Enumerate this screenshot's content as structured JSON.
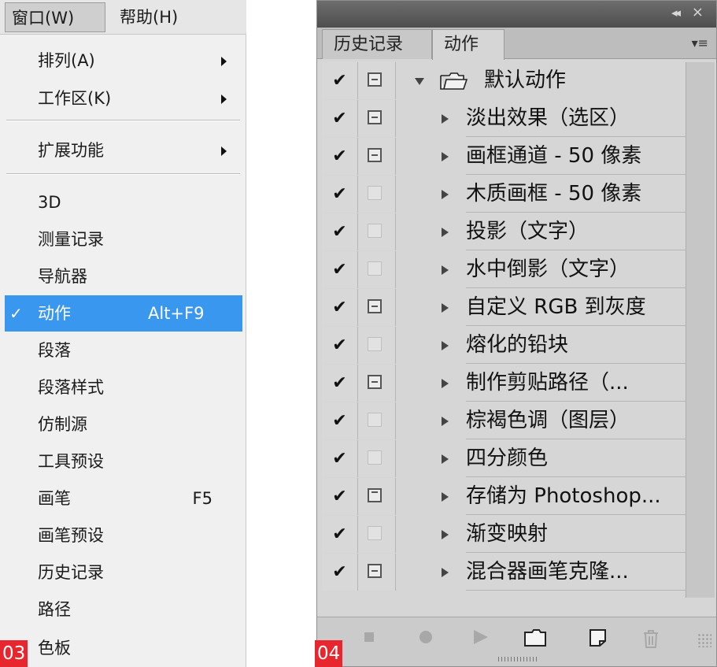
{
  "menubar": {
    "window_label": "窗口(W)",
    "help_label": "帮助(H)"
  },
  "window_menu": {
    "items": [
      {
        "label": "排列(A)",
        "submenu": true
      },
      {
        "label": "工作区(K)",
        "submenu": true
      },
      {
        "label": "扩展功能",
        "submenu": true
      },
      {
        "label": "3D"
      },
      {
        "label": "测量记录"
      },
      {
        "label": "导航器"
      },
      {
        "label": "动作",
        "shortcut": "Alt+F9",
        "checked": true,
        "highlighted": true
      },
      {
        "label": "段落"
      },
      {
        "label": "段落样式"
      },
      {
        "label": "仿制源"
      },
      {
        "label": "工具预设"
      },
      {
        "label": "画笔",
        "shortcut": "F5"
      },
      {
        "label": "画笔预设"
      },
      {
        "label": "历史记录"
      },
      {
        "label": "路径"
      },
      {
        "label": "色板"
      }
    ],
    "check_glyph": "✓"
  },
  "badges": {
    "left": "03",
    "right": "04"
  },
  "actions_panel": {
    "tabs": [
      {
        "label": "历史记录"
      },
      {
        "label": "动作",
        "active": true
      }
    ],
    "collapse_glyph": "◂◂",
    "close_glyph": "×",
    "menu_glyph": "▾≡",
    "check_glyph": "✔",
    "set": {
      "name": "默认动作",
      "dialog": "partial"
    },
    "actions": [
      {
        "name": "淡出效果（选区）",
        "dialog": "partial"
      },
      {
        "name": "画框通道 - 50 像素",
        "dialog": "partial"
      },
      {
        "name": "木质画框 - 50 像素",
        "dialog": "none"
      },
      {
        "name": "投影（文字）",
        "dialog": "none"
      },
      {
        "name": "水中倒影（文字）",
        "dialog": "none"
      },
      {
        "name": "自定义 RGB 到灰度",
        "dialog": "partial"
      },
      {
        "name": "熔化的铅块",
        "dialog": "none"
      },
      {
        "name": "制作剪贴路径（...",
        "dialog": "partial"
      },
      {
        "name": "棕褐色调（图层）",
        "dialog": "none"
      },
      {
        "name": "四分颜色",
        "dialog": "none"
      },
      {
        "name": "存储为 Photoshop...",
        "dialog": "full"
      },
      {
        "name": "渐变映射",
        "dialog": "none"
      },
      {
        "name": "混合器画笔克隆...",
        "dialog": "partial"
      }
    ],
    "bottom_buttons": [
      "stop-icon",
      "record-icon",
      "play-icon",
      "new-set-icon",
      "new-action-icon",
      "delete-icon"
    ]
  },
  "colors": {
    "highlight": "#3a97ef",
    "badge": "#e8262e"
  }
}
